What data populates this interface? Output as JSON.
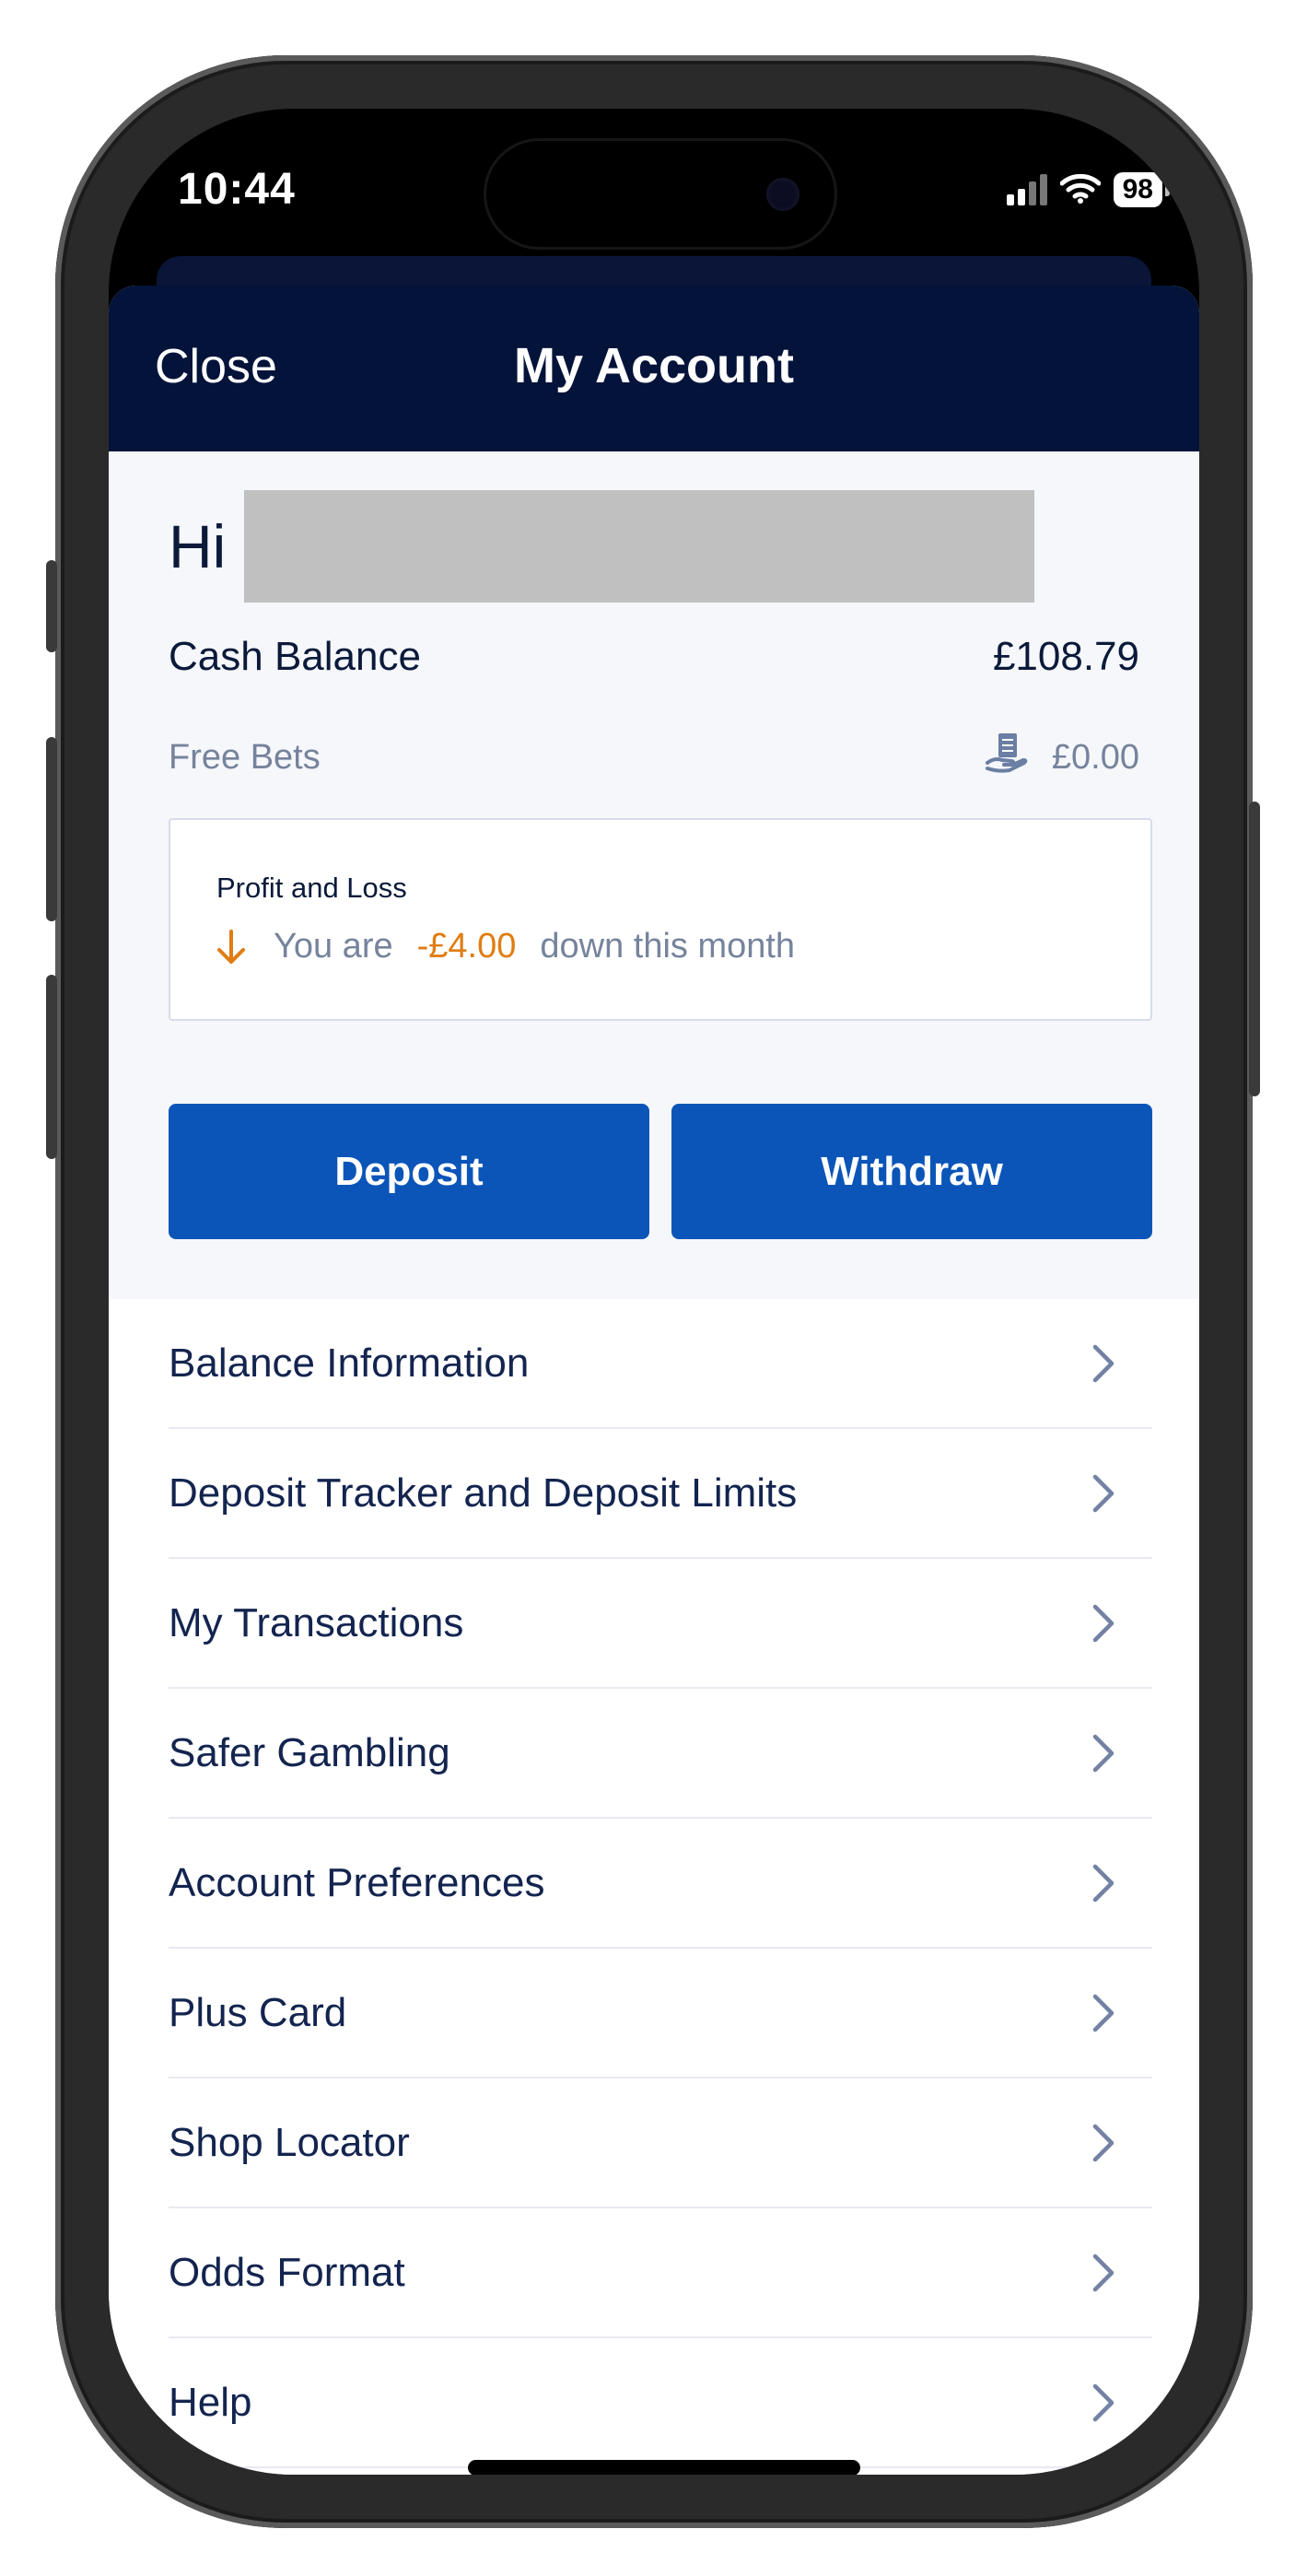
{
  "status_bar": {
    "time": "10:44",
    "battery": "98"
  },
  "header": {
    "close_label": "Close",
    "title": "My Account"
  },
  "greeting": {
    "prefix": "Hi"
  },
  "balance": {
    "cash_label": "Cash Balance",
    "cash_value": "£108.79",
    "free_bets_label": "Free Bets",
    "free_bets_value": "£0.00"
  },
  "profit_loss": {
    "title": "Profit and Loss",
    "prefix": "You are",
    "amount": "-£4.00",
    "suffix": "down this month"
  },
  "actions": {
    "deposit_label": "Deposit",
    "withdraw_label": "Withdraw"
  },
  "menu": {
    "items": [
      {
        "label": "Balance Information"
      },
      {
        "label": "Deposit Tracker and Deposit Limits"
      },
      {
        "label": "My Transactions"
      },
      {
        "label": "Safer Gambling"
      },
      {
        "label": "Account Preferences"
      },
      {
        "label": "Plus Card"
      },
      {
        "label": "Shop Locator"
      },
      {
        "label": "Odds Format"
      },
      {
        "label": "Help"
      }
    ]
  },
  "colors": {
    "header_bg": "#03133a",
    "button_bg": "#0b55b8",
    "loss_amount": "#e07d12",
    "muted_text": "#76839c"
  },
  "icons": {
    "free_bets": "hand-money-icon",
    "loss_direction": "arrow-down-icon",
    "menu_chevron": "chevron-right-icon"
  }
}
